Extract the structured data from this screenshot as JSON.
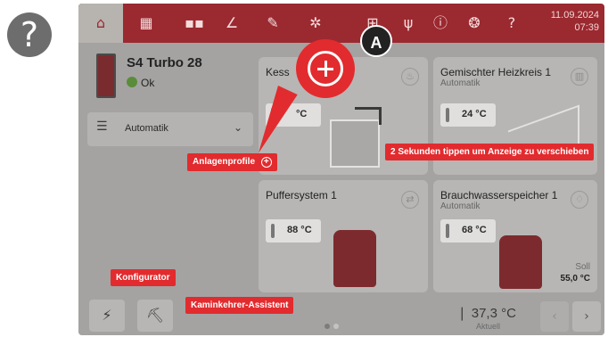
{
  "topbar": {
    "date": "11.09.2024",
    "time": "07:39",
    "icons": [
      "home-icon",
      "schedule-icon",
      "modules-icon",
      "chart-icon",
      "wrench-icon",
      "gear-icon",
      "network-icon",
      "usb-icon",
      "info-icon",
      "profile-icon",
      "help-off-icon"
    ]
  },
  "device": {
    "name": "S4 Turbo 28",
    "status": "Ok"
  },
  "mode": {
    "label": "Automatik"
  },
  "cards": {
    "kessel": {
      "title": "Kess",
      "temp": "°C"
    },
    "heizkreis": {
      "title": "Gemischter Heizkreis 1",
      "subtitle": "Automatik",
      "temp": "24 °C"
    },
    "puffer": {
      "title": "Puffersystem 1",
      "temp": "88 °C"
    },
    "brauchwasser": {
      "title": "Brauchwasserspeicher 1",
      "subtitle": "Automatik",
      "temp": "68 °C",
      "soll_label": "Soll",
      "soll_value": "55,0 °C"
    }
  },
  "bottom": {
    "actual_temp": "37,3 °C",
    "actual_label": "Aktuell"
  },
  "callouts": {
    "anlagenprofile": "Anlagenprofile",
    "verschieben": "2 Sekunden tippen um Anzeige zu verschieben",
    "konfigurator": "Konfigurator",
    "kaminkehrer": "Kaminkehrer-Assistent",
    "badge": "A"
  },
  "colors": {
    "accent": "#e22b2e",
    "topbar": "#9b2930",
    "boiler": "#7d2a2e"
  }
}
